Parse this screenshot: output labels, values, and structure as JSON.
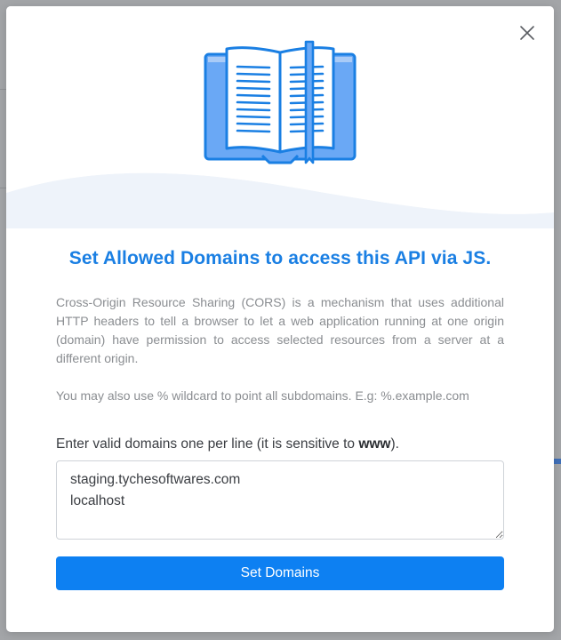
{
  "modal": {
    "close_label": "×",
    "title": "Set Allowed Domains to access this API via JS.",
    "description": "Cross-Origin Resource Sharing (CORS) is a mechanism that uses additional HTTP headers to tell a browser to let a web application running at one origin (domain) have permission to access selected resources from a server at a different origin.",
    "wildcard_note": "You may also use % wildcard to point all subdomains. E.g: %.example.com",
    "domains_label_prefix": "Enter valid domains one per line (it is sensitive to ",
    "domains_label_emphasis": "www",
    "domains_label_suffix": ").",
    "domains_value": "staging.tychesoftwares.com\nlocalhost",
    "submit_label": "Set Domains"
  },
  "colors": {
    "accent": "#0d80f2",
    "title": "#1a7fe3",
    "illustration_outline": "#1a7fe3",
    "illustration_fill": "#6aa8f5",
    "hero_wave": "#eef3fa"
  },
  "icons": {
    "close": "close-icon",
    "illustration": "open-book-icon"
  }
}
